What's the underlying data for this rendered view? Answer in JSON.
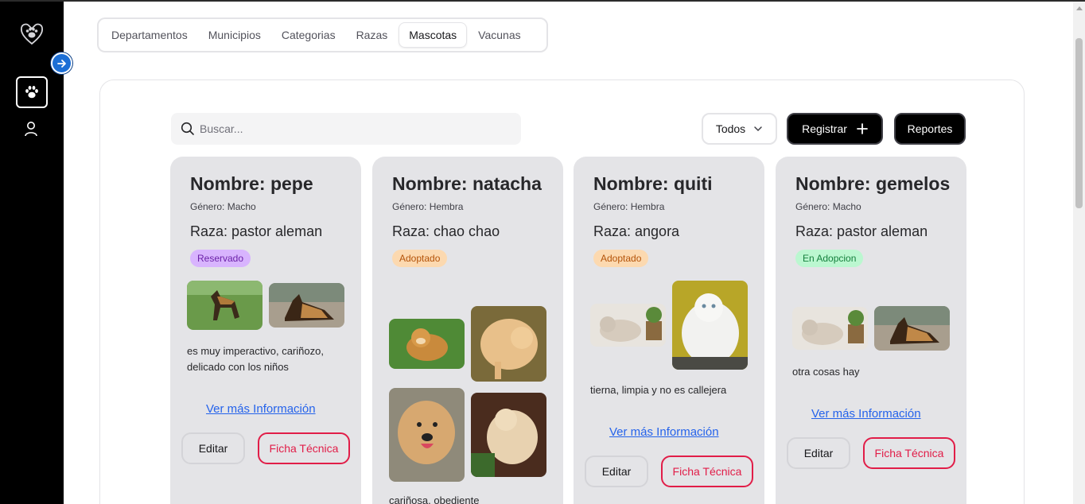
{
  "sidebar": {
    "logo_icon": "paw-heart-logo",
    "items": [
      {
        "icon": "paw-icon"
      },
      {
        "icon": "user-icon"
      }
    ],
    "expand_icon": "arrow-right-icon"
  },
  "tabs": [
    {
      "label": "Departamentos"
    },
    {
      "label": "Municipios"
    },
    {
      "label": "Categorias"
    },
    {
      "label": "Razas"
    },
    {
      "label": "Mascotas",
      "active": true
    },
    {
      "label": "Vacunas"
    }
  ],
  "toolbar": {
    "search_placeholder": "Buscar...",
    "filter_value": "Todos",
    "register_label": "Registrar",
    "reports_label": "Reportes"
  },
  "pets": [
    {
      "name": "Nombre: pepe",
      "gender": "Género: Macho",
      "breed": "Raza: pastor aleman",
      "status": "Reservado",
      "description": "es muy imperactivo, cariñozo, delicado con los niños",
      "more_label": "Ver más Información",
      "edit_label": "Editar",
      "ficha_label": "Ficha Técnica"
    },
    {
      "name": "Nombre: natacha",
      "gender": "Género: Hembra",
      "breed": "Raza: chao chao",
      "status": "Adoptado",
      "description": "cariñosa, obediente"
    },
    {
      "name": "Nombre: quiti",
      "gender": "Género: Hembra",
      "breed": "Raza: angora",
      "status": "Adoptado",
      "description": "tierna, limpia y no es callejera",
      "more_label": "Ver más Información",
      "edit_label": "Editar",
      "ficha_label": "Ficha Técnica"
    },
    {
      "name": "Nombre: gemelos",
      "gender": "Género: Macho",
      "breed": "Raza: pastor aleman",
      "status": "En Adopcion",
      "description": "otra cosas hay",
      "more_label": "Ver más Información",
      "edit_label": "Editar",
      "ficha_label": "Ficha Técnica"
    }
  ],
  "colors": {
    "sidebar_bg": "#000000",
    "card_bg": "#e4e4e7",
    "link": "#2563eb",
    "ficha_accent": "#e11d48",
    "badge_reservado": "#d8b4fe",
    "badge_adoptado": "#fcd9b0",
    "badge_adopcion": "#bbf7d0"
  }
}
